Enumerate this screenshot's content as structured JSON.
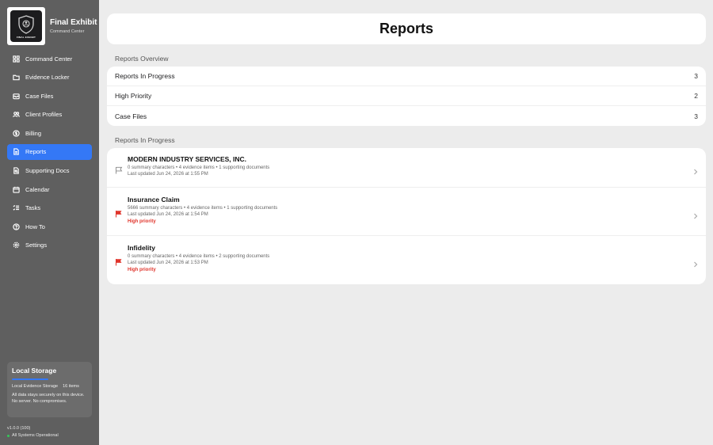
{
  "brand": {
    "title": "Final Exhibit",
    "subtitle": "Command Center",
    "logo_text": "FINAL EXHIBIT"
  },
  "nav": [
    {
      "label": "Command Center",
      "icon": "grid-icon",
      "active": false
    },
    {
      "label": "Evidence Locker",
      "icon": "folder-icon",
      "active": false
    },
    {
      "label": "Case Files",
      "icon": "tray-icon",
      "active": false
    },
    {
      "label": "Client Profiles",
      "icon": "people-icon",
      "active": false
    },
    {
      "label": "Billing",
      "icon": "dollar-circle-icon",
      "active": false
    },
    {
      "label": "Reports",
      "icon": "document-icon",
      "active": true
    },
    {
      "label": "Supporting Docs",
      "icon": "doc-search-icon",
      "active": false
    },
    {
      "label": "Calendar",
      "icon": "calendar-icon",
      "active": false
    },
    {
      "label": "Tasks",
      "icon": "checklist-icon",
      "active": false
    },
    {
      "label": "How To",
      "icon": "question-circle-icon",
      "active": false
    },
    {
      "label": "Settings",
      "icon": "gear-icon",
      "active": false
    }
  ],
  "storage": {
    "title": "Local Storage",
    "label": "Local Evidence Storage",
    "count": "16 items",
    "note": "All data stays securely on this device. No server. No compromises."
  },
  "footer": {
    "version": "v1.0.0 (100)",
    "status": "All Systems Operational"
  },
  "header": {
    "title": "Reports"
  },
  "overview": {
    "label": "Reports Overview",
    "rows": [
      {
        "label": "Reports In Progress",
        "count": "3"
      },
      {
        "label": "High Priority",
        "count": "2"
      },
      {
        "label": "Case Files",
        "count": "3"
      }
    ]
  },
  "in_progress": {
    "label": "Reports In Progress",
    "items": [
      {
        "title": "MODERN INDUSTRY SERVICES, INC.",
        "meta": "0 summary characters • 4 evidence items • 1 supporting documents",
        "updated": "Last updated Jun 24, 2026 at 1:55 PM",
        "priority": "",
        "flag_color": "#888888"
      },
      {
        "title": "Insurance Claim",
        "meta": "5666 summary characters • 4 evidence items • 1 supporting documents",
        "updated": "Last updated Jun 24, 2026 at 1:54 PM",
        "priority": "High priority",
        "flag_color": "#e0342b"
      },
      {
        "title": "Infidelity",
        "meta": "0 summary characters • 4 evidence items • 2 supporting documents",
        "updated": "Last updated Jun 24, 2026 at 1:53 PM",
        "priority": "High priority",
        "flag_color": "#e0342b"
      }
    ]
  },
  "colors": {
    "accent": "#3478f6",
    "danger": "#e0342b",
    "sidebar": "#5f5f5f",
    "status_ok": "#34c759"
  }
}
